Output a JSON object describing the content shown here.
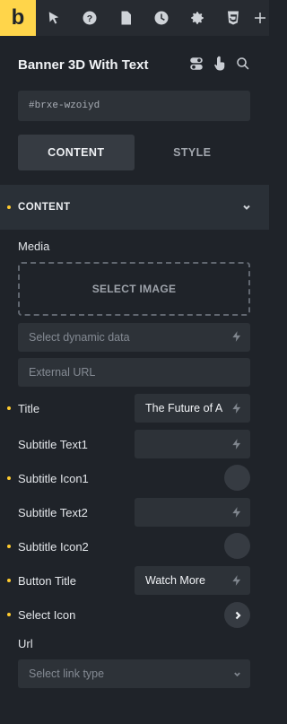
{
  "toolbar": {
    "logo": "b",
    "icons": [
      "cursor-icon",
      "help-icon",
      "page-icon",
      "history-icon",
      "settings-icon",
      "html5-icon",
      "add-icon"
    ]
  },
  "header": {
    "title": "Banner 3D With Text"
  },
  "element_id": "#brxe-wzoiyd",
  "tabs": [
    {
      "label": "CONTENT",
      "active": true
    },
    {
      "label": "STYLE",
      "active": false
    }
  ],
  "section": {
    "label": "CONTENT"
  },
  "fields": {
    "media_label": "Media",
    "select_image": "SELECT IMAGE",
    "dynamic_placeholder": "Select dynamic data",
    "external_url_placeholder": "External URL",
    "title_label": "Title",
    "title_value": "The Future of A",
    "subtitle_text1_label": "Subtitle Text1",
    "subtitle_icon1_label": "Subtitle Icon1",
    "subtitle_text2_label": "Subtitle Text2",
    "subtitle_icon2_label": "Subtitle Icon2",
    "button_title_label": "Button Title",
    "button_title_value": "Watch More",
    "select_icon_label": "Select Icon",
    "url_label": "Url",
    "link_type_placeholder": "Select link type"
  },
  "colors": {
    "accent": "#ffd54a",
    "background": "#1f2329",
    "indicator": "#ffcb2f"
  }
}
